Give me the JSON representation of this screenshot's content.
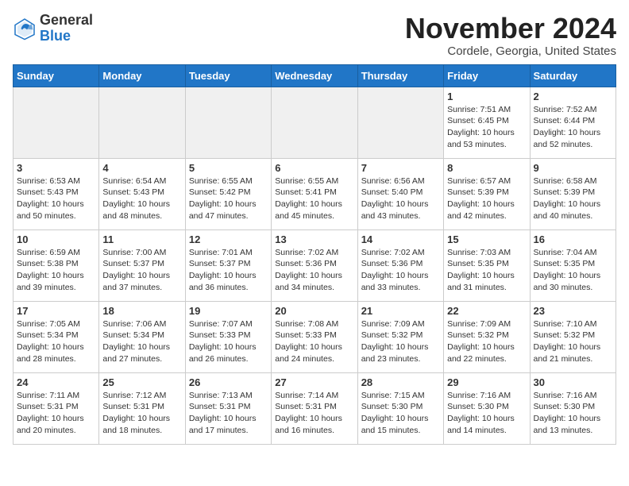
{
  "header": {
    "logo_general": "General",
    "logo_blue": "Blue",
    "month_title": "November 2024",
    "location": "Cordele, Georgia, United States"
  },
  "weekdays": [
    "Sunday",
    "Monday",
    "Tuesday",
    "Wednesday",
    "Thursday",
    "Friday",
    "Saturday"
  ],
  "weeks": [
    [
      {
        "day": "",
        "info": ""
      },
      {
        "day": "",
        "info": ""
      },
      {
        "day": "",
        "info": ""
      },
      {
        "day": "",
        "info": ""
      },
      {
        "day": "",
        "info": ""
      },
      {
        "day": "1",
        "info": "Sunrise: 7:51 AM\nSunset: 6:45 PM\nDaylight: 10 hours and 53 minutes."
      },
      {
        "day": "2",
        "info": "Sunrise: 7:52 AM\nSunset: 6:44 PM\nDaylight: 10 hours and 52 minutes."
      }
    ],
    [
      {
        "day": "3",
        "info": "Sunrise: 6:53 AM\nSunset: 5:43 PM\nDaylight: 10 hours and 50 minutes."
      },
      {
        "day": "4",
        "info": "Sunrise: 6:54 AM\nSunset: 5:43 PM\nDaylight: 10 hours and 48 minutes."
      },
      {
        "day": "5",
        "info": "Sunrise: 6:55 AM\nSunset: 5:42 PM\nDaylight: 10 hours and 47 minutes."
      },
      {
        "day": "6",
        "info": "Sunrise: 6:55 AM\nSunset: 5:41 PM\nDaylight: 10 hours and 45 minutes."
      },
      {
        "day": "7",
        "info": "Sunrise: 6:56 AM\nSunset: 5:40 PM\nDaylight: 10 hours and 43 minutes."
      },
      {
        "day": "8",
        "info": "Sunrise: 6:57 AM\nSunset: 5:39 PM\nDaylight: 10 hours and 42 minutes."
      },
      {
        "day": "9",
        "info": "Sunrise: 6:58 AM\nSunset: 5:39 PM\nDaylight: 10 hours and 40 minutes."
      }
    ],
    [
      {
        "day": "10",
        "info": "Sunrise: 6:59 AM\nSunset: 5:38 PM\nDaylight: 10 hours and 39 minutes."
      },
      {
        "day": "11",
        "info": "Sunrise: 7:00 AM\nSunset: 5:37 PM\nDaylight: 10 hours and 37 minutes."
      },
      {
        "day": "12",
        "info": "Sunrise: 7:01 AM\nSunset: 5:37 PM\nDaylight: 10 hours and 36 minutes."
      },
      {
        "day": "13",
        "info": "Sunrise: 7:02 AM\nSunset: 5:36 PM\nDaylight: 10 hours and 34 minutes."
      },
      {
        "day": "14",
        "info": "Sunrise: 7:02 AM\nSunset: 5:36 PM\nDaylight: 10 hours and 33 minutes."
      },
      {
        "day": "15",
        "info": "Sunrise: 7:03 AM\nSunset: 5:35 PM\nDaylight: 10 hours and 31 minutes."
      },
      {
        "day": "16",
        "info": "Sunrise: 7:04 AM\nSunset: 5:35 PM\nDaylight: 10 hours and 30 minutes."
      }
    ],
    [
      {
        "day": "17",
        "info": "Sunrise: 7:05 AM\nSunset: 5:34 PM\nDaylight: 10 hours and 28 minutes."
      },
      {
        "day": "18",
        "info": "Sunrise: 7:06 AM\nSunset: 5:34 PM\nDaylight: 10 hours and 27 minutes."
      },
      {
        "day": "19",
        "info": "Sunrise: 7:07 AM\nSunset: 5:33 PM\nDaylight: 10 hours and 26 minutes."
      },
      {
        "day": "20",
        "info": "Sunrise: 7:08 AM\nSunset: 5:33 PM\nDaylight: 10 hours and 24 minutes."
      },
      {
        "day": "21",
        "info": "Sunrise: 7:09 AM\nSunset: 5:32 PM\nDaylight: 10 hours and 23 minutes."
      },
      {
        "day": "22",
        "info": "Sunrise: 7:09 AM\nSunset: 5:32 PM\nDaylight: 10 hours and 22 minutes."
      },
      {
        "day": "23",
        "info": "Sunrise: 7:10 AM\nSunset: 5:32 PM\nDaylight: 10 hours and 21 minutes."
      }
    ],
    [
      {
        "day": "24",
        "info": "Sunrise: 7:11 AM\nSunset: 5:31 PM\nDaylight: 10 hours and 20 minutes."
      },
      {
        "day": "25",
        "info": "Sunrise: 7:12 AM\nSunset: 5:31 PM\nDaylight: 10 hours and 18 minutes."
      },
      {
        "day": "26",
        "info": "Sunrise: 7:13 AM\nSunset: 5:31 PM\nDaylight: 10 hours and 17 minutes."
      },
      {
        "day": "27",
        "info": "Sunrise: 7:14 AM\nSunset: 5:31 PM\nDaylight: 10 hours and 16 minutes."
      },
      {
        "day": "28",
        "info": "Sunrise: 7:15 AM\nSunset: 5:30 PM\nDaylight: 10 hours and 15 minutes."
      },
      {
        "day": "29",
        "info": "Sunrise: 7:16 AM\nSunset: 5:30 PM\nDaylight: 10 hours and 14 minutes."
      },
      {
        "day": "30",
        "info": "Sunrise: 7:16 AM\nSunset: 5:30 PM\nDaylight: 10 hours and 13 minutes."
      }
    ]
  ]
}
